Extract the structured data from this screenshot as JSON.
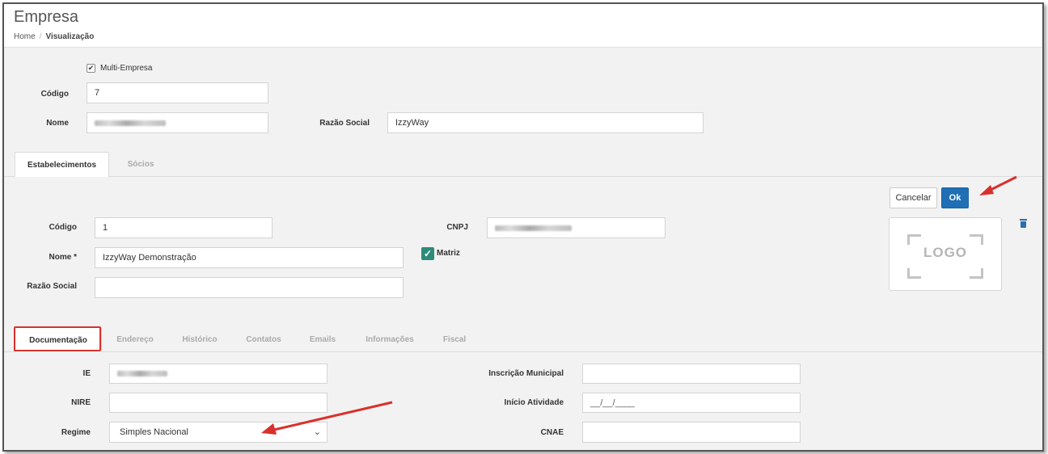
{
  "header": {
    "title": "Empresa",
    "breadcrumb": {
      "home": "Home",
      "separator": "/",
      "current": "Visualização"
    }
  },
  "empresa": {
    "multi_empresa_label": "Multi-Empresa",
    "multi_empresa_checked": true,
    "codigo_label": "Código",
    "codigo_value": "7",
    "nome_label": "Nome",
    "razao_social_label": "Razão Social",
    "razao_social_value": "IzzyWay"
  },
  "main_tabs": [
    {
      "label": "Estabelecimentos",
      "active": true
    },
    {
      "label": "Sócios",
      "active": false
    }
  ],
  "actions": {
    "cancel_label": "Cancelar",
    "ok_label": "Ok"
  },
  "estabelecimento": {
    "codigo_label": "Código",
    "codigo_value": "1",
    "cnpj_label": "CNPJ",
    "nome_label": "Nome *",
    "nome_value": "IzzyWay Demonstração",
    "matriz_label": "Matriz",
    "matriz_checked": true,
    "razao_social_label": "Razão Social",
    "razao_social_value": "",
    "logo_text": "LOGO",
    "trash_icon": "trash-icon"
  },
  "sub_tabs": [
    {
      "label": "Documentação",
      "active": true
    },
    {
      "label": "Endereço",
      "active": false
    },
    {
      "label": "Histórico",
      "active": false
    },
    {
      "label": "Contatos",
      "active": false
    },
    {
      "label": "Emails",
      "active": false
    },
    {
      "label": "Informações",
      "active": false
    },
    {
      "label": "Fiscal",
      "active": false
    }
  ],
  "documentacao": {
    "ie_label": "IE",
    "inscricao_municipal_label": "Inscrição Municipal",
    "inscricao_municipal_value": "",
    "nire_label": "NIRE",
    "nire_value": "",
    "inicio_atividade_label": "Início Atividade",
    "inicio_atividade_value": "__/__/____",
    "regime_label": "Regime",
    "regime_value": "Simples Nacional",
    "cnae_label": "CNAE",
    "cnae_value": ""
  },
  "colors": {
    "ok_button": "#1f6fb5",
    "matriz_check": "#2e8b79",
    "annotation_red": "#d9302b",
    "page_background": "#f2f2f2"
  }
}
